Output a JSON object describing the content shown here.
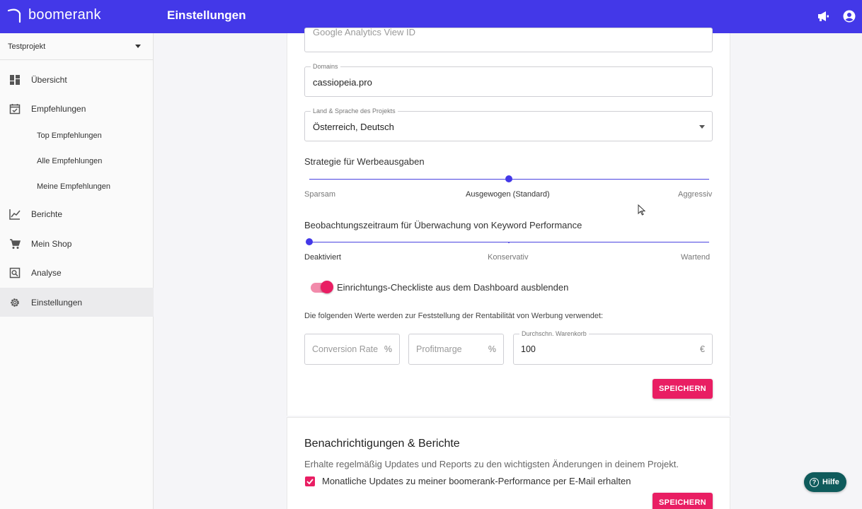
{
  "app": {
    "brand": "boomerank",
    "page_title": "Einstellungen"
  },
  "header": {
    "icons": [
      "megaphone-icon",
      "account-icon"
    ]
  },
  "sidebar": {
    "project": "Testprojekt",
    "items": [
      {
        "label": "Übersicht",
        "icon": "dashboard-icon"
      },
      {
        "label": "Empfehlungen",
        "icon": "calendar-check-icon"
      },
      {
        "label": "Berichte",
        "icon": "chart-line-icon"
      },
      {
        "label": "Mein Shop",
        "icon": "cart-icon"
      },
      {
        "label": "Analyse",
        "icon": "analytics-icon"
      },
      {
        "label": "Einstellungen",
        "icon": "gear-icon"
      }
    ],
    "sub_items": [
      "Top Empfehlungen",
      "Alle Empfehlungen",
      "Meine Empfehlungen"
    ]
  },
  "settings": {
    "ga_view_id": {
      "placeholder": "Google Analytics View ID"
    },
    "domains": {
      "label": "Domains",
      "value": "cassiopeia.pro"
    },
    "country_language": {
      "label": "Land & Sprache des Projekts",
      "value": "Österreich, Deutsch"
    },
    "spend_strategy": {
      "label": "Strategie für Werbeausgaben",
      "options": [
        "Sparsam",
        "Ausgewogen (Standard)",
        "Aggressiv"
      ],
      "selected_index": 1
    },
    "observation": {
      "label": "Beobachtungszeitraum für Überwachung von Keyword Performance",
      "options": [
        "Deaktiviert",
        "Konservativ",
        "Wartend"
      ],
      "selected_index": 0
    },
    "checklist_toggle": {
      "label": "Einrichtungs-Checkliste aus dem Dashboard ausblenden",
      "on": true
    },
    "profit_info": "Die folgenden Werte werden zur Feststellung der Rentabilität von Werbung verwendet:",
    "conversion_rate": {
      "placeholder": "Conversion Rate",
      "suffix": "%"
    },
    "profit_margin": {
      "placeholder": "Profitmarge",
      "suffix": "%"
    },
    "avg_cart": {
      "label": "Durchschn. Warenkorb",
      "value": "100",
      "suffix": "€"
    },
    "save_label": "SPEICHERN"
  },
  "notifications": {
    "title": "Benachrichtigungen & Berichte",
    "subtitle": "Erhalte regelmäßig Updates und Reports zu den wichtigsten Änderungen in deinem Projekt.",
    "monthly_updates": {
      "label": "Monatliche Updates zu meiner boomerank-Performance per E-Mail erhalten",
      "checked": true
    },
    "save_label": "SPEICHERN"
  },
  "help": {
    "label": "Hilfe"
  },
  "colors": {
    "primary": "#4338e8",
    "accent": "#e91e63",
    "help": "#0f5b5c"
  }
}
